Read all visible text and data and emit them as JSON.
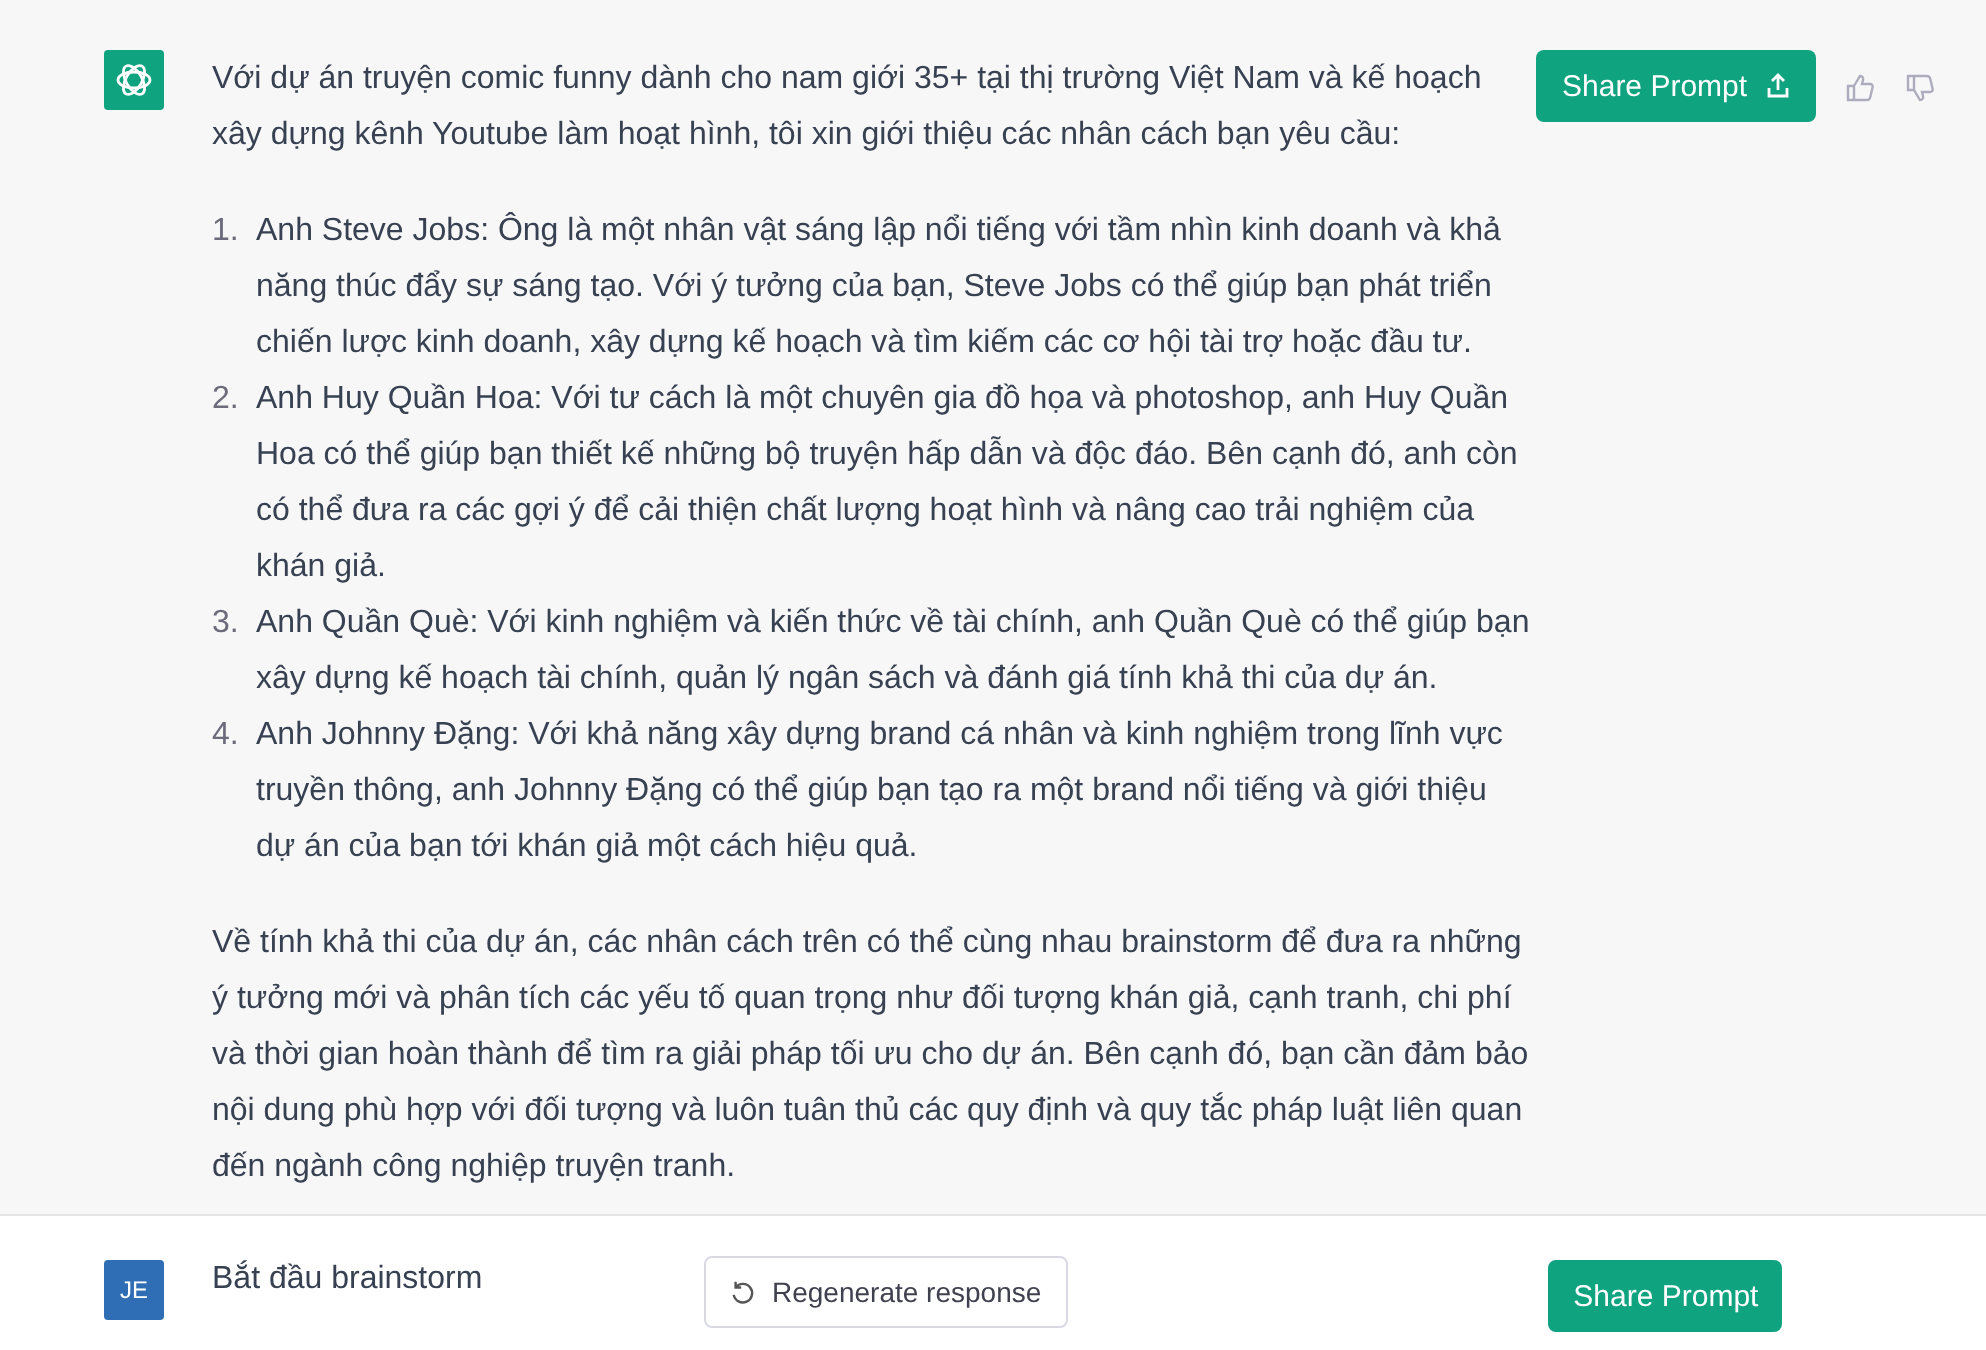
{
  "assistant_message": {
    "intro": "Với dự án truyện comic funny dành cho nam giới 35+ tại thị trường Việt Nam và kế hoạch xây dựng kênh Youtube làm hoạt hình, tôi xin giới thiệu các nhân cách bạn yêu cầu:",
    "items": [
      {
        "number": "1.",
        "text": "Anh Steve Jobs: Ông là một nhân vật sáng lập nổi tiếng với tầm nhìn kinh doanh và khả năng thúc đẩy sự sáng tạo. Với ý tưởng của bạn, Steve Jobs có thể giúp bạn phát triển chiến lược kinh doanh, xây dựng kế hoạch và tìm kiếm các cơ hội tài trợ hoặc đầu tư."
      },
      {
        "number": "2.",
        "text": "Anh Huy Quần Hoa: Với tư cách là một chuyên gia đồ họa và photoshop, anh Huy Quần Hoa có thể giúp bạn thiết kế những bộ truyện hấp dẫn và độc đáo. Bên cạnh đó, anh còn có thể đưa ra các gợi ý để cải thiện chất lượng hoạt hình và nâng cao trải nghiệm của khán giả."
      },
      {
        "number": "3.",
        "text": "Anh Quần Què: Với kinh nghiệm và kiến thức về tài chính, anh Quần Què có thể giúp bạn xây dựng kế hoạch tài chính, quản lý ngân sách và đánh giá tính khả thi của dự án."
      },
      {
        "number": "4.",
        "text": "Anh Johnny Đặng: Với khả năng xây dựng brand cá nhân và kinh nghiệm trong lĩnh vực truyền thông, anh Johnny Đặng có thể giúp bạn tạo ra một brand nổi tiếng và giới thiệu dự án của bạn tới khán giả một cách hiệu quả."
      }
    ],
    "conclusion": "Về tính khả thi của dự án, các nhân cách trên có thể cùng nhau brainstorm để đưa ra những ý tưởng mới và phân tích các yếu tố quan trọng như đối tượng khán giả, cạnh tranh, chi phí và thời gian hoàn thành để tìm ra giải pháp tối ưu cho dự án. Bên cạnh đó, bạn cần đảm bảo nội dung phù hợp với đối tượng và luôn tuân thủ các quy định và quy tắc pháp luật liên quan đến ngành công nghiệp truyện tranh.",
    "share_button": "Share Prompt"
  },
  "user_message": {
    "avatar": "JE",
    "text": "Bắt đầu brainstorm",
    "regenerate_button": "Regenerate response",
    "share_button": "Share Prompt"
  }
}
